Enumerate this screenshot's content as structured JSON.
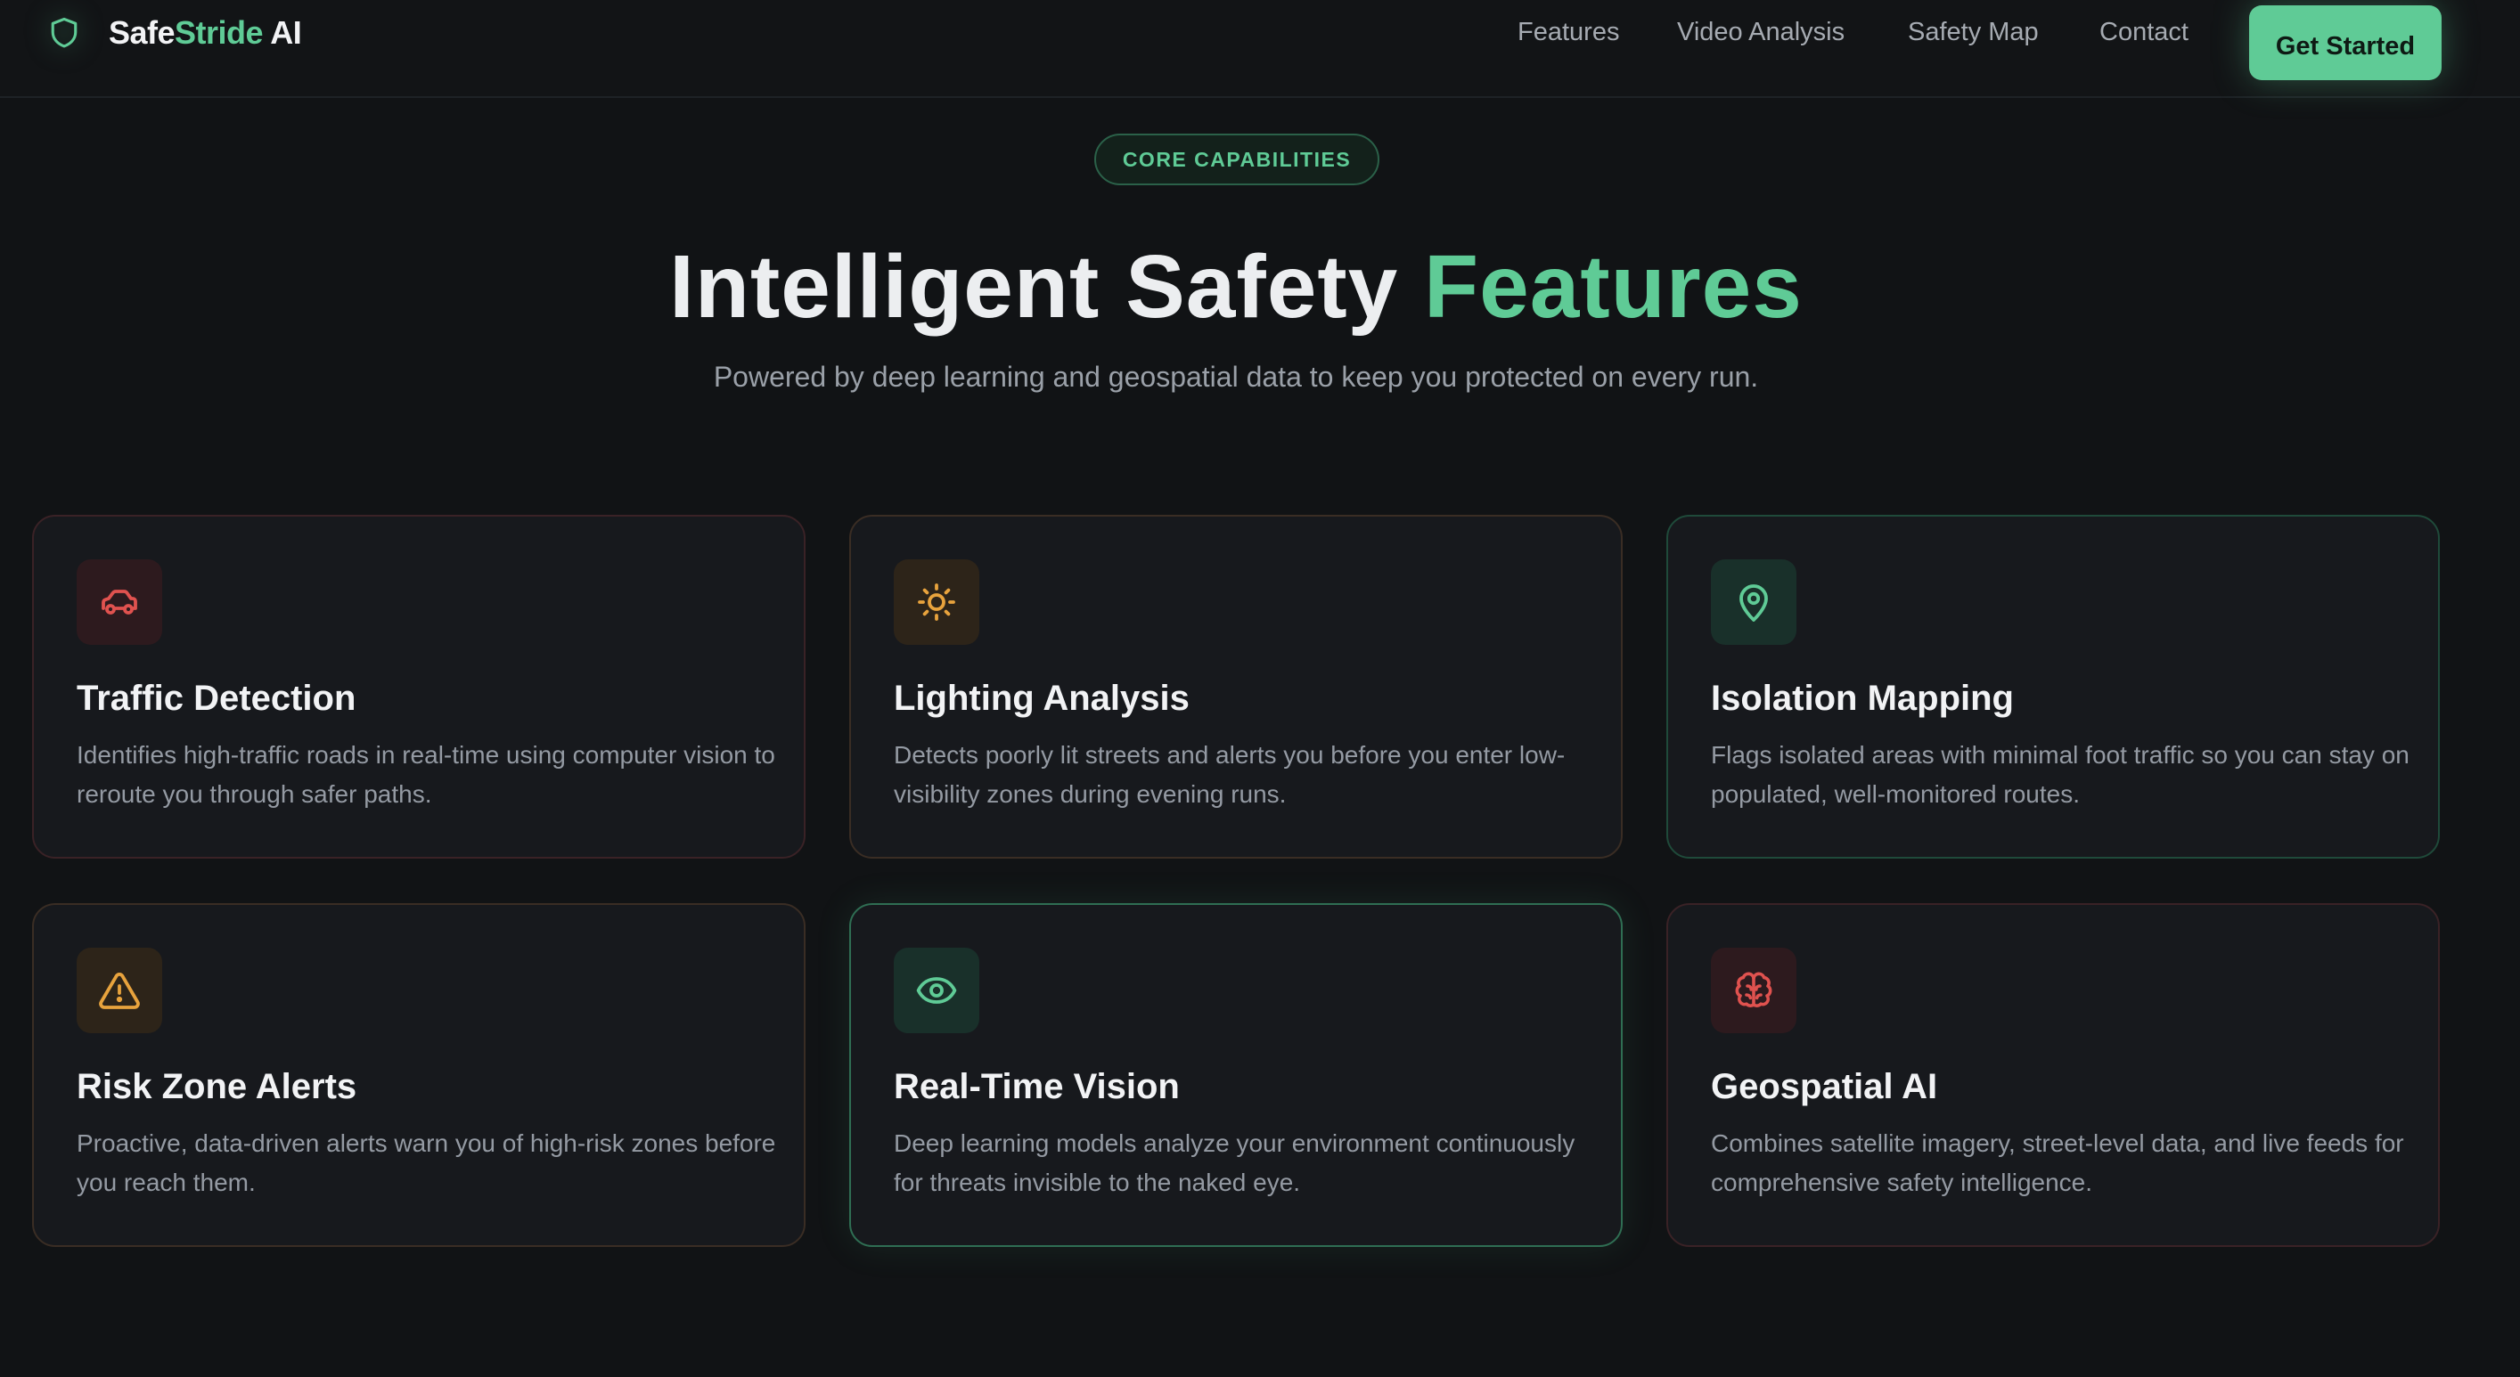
{
  "brand": {
    "part1": "Safe",
    "part2": "Stride",
    "part3": " AI",
    "icon": "shield-icon"
  },
  "nav": {
    "links": [
      "Features",
      "Video Analysis",
      "Safety Map",
      "Contact"
    ],
    "cta_label": "Get Started"
  },
  "hero": {
    "badge": "CORE CAPABILITIES",
    "title_main": "Intelligent Safety ",
    "title_accent": "Features",
    "subtitle": "Powered by deep learning and geospatial data to keep you protected on every run."
  },
  "features": [
    {
      "title": "Traffic Detection",
      "desc": "Identifies high-traffic roads in real-time using computer vision to reroute you through safer paths.",
      "icon": "car-icon",
      "accent": "#e0524f"
    },
    {
      "title": "Lighting Analysis",
      "desc": "Detects poorly lit streets and alerts you before you enter low-visibility zones during evening runs.",
      "icon": "sun-icon",
      "accent": "#e8a33d"
    },
    {
      "title": "Isolation Mapping",
      "desc": "Flags isolated areas with minimal foot traffic so you can stay on populated, well-monitored routes.",
      "icon": "map-pin-icon",
      "accent": "#5fcb96"
    },
    {
      "title": "Risk Zone Alerts",
      "desc": "Proactive, data-driven alerts warn you of high-risk zones before you reach them.",
      "icon": "warning-icon",
      "accent": "#e8a33d"
    },
    {
      "title": "Real-Time Vision",
      "desc": "Deep learning models analyze your environment continuously for threats invisible to the naked eye.",
      "icon": "eye-icon",
      "accent": "#5fcb96"
    },
    {
      "title": "Geospatial AI",
      "desc": "Combines satellite imagery, street-level data, and live feeds for comprehensive safety intelligence.",
      "icon": "brain-icon",
      "accent": "#e0524f"
    }
  ],
  "colors": {
    "background": "#111315",
    "accent_green": "#5fcb96",
    "accent_red": "#e0524f",
    "accent_amber": "#e8a33d"
  }
}
